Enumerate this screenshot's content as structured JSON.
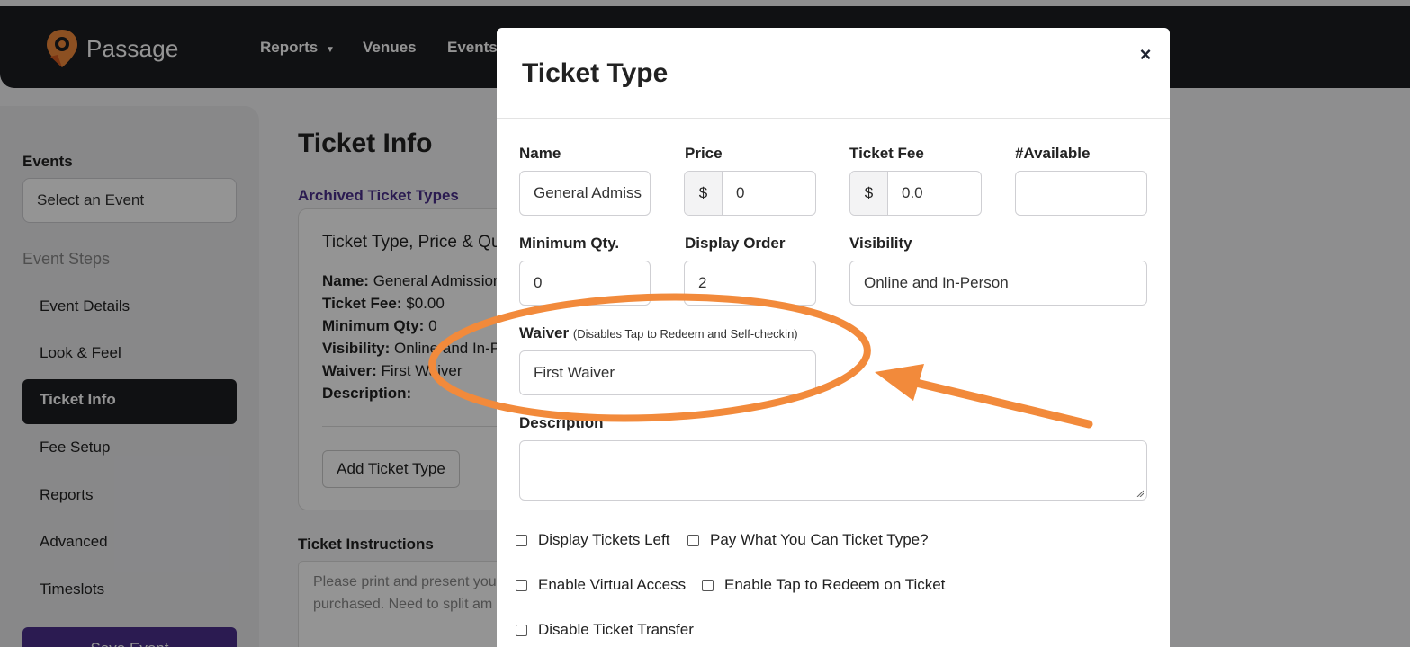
{
  "brand": {
    "name": "Passage",
    "accent": "#f28a3b"
  },
  "nav": {
    "reports": "Reports",
    "venues": "Venues",
    "events": "Events"
  },
  "sidebar": {
    "events_label": "Events",
    "event_select_placeholder": "Select an Event",
    "steps_label": "Event Steps",
    "items": [
      {
        "label": "Event Details"
      },
      {
        "label": "Look & Feel"
      },
      {
        "label": "Ticket Info"
      },
      {
        "label": "Fee Setup"
      },
      {
        "label": "Reports"
      },
      {
        "label": "Advanced"
      },
      {
        "label": "Timeslots"
      }
    ],
    "save_label": "Save Event"
  },
  "main": {
    "title": "Ticket Info",
    "archived_link": "Archived Ticket Types",
    "card": {
      "heading": "Ticket Type, Price & Qu",
      "name_label": "Name:",
      "name_value": "General Admission",
      "fee_label": "Ticket Fee:",
      "fee_value": "$0.00",
      "min_label": "Minimum Qty:",
      "min_value": "0",
      "visibility_label": "Visibility:",
      "visibility_value": "Online and In-Pe",
      "waiver_label": "Waiver:",
      "waiver_value": "First Waiver",
      "description_label": "Description:",
      "add_button": "Add Ticket Type"
    },
    "instructions": {
      "label": "Ticket Instructions",
      "line1": "Please print and present you",
      "line2": "purchased. Need to split am"
    }
  },
  "modal": {
    "title": "Ticket Type",
    "close": "×",
    "fields": {
      "name": {
        "label": "Name",
        "value": "General Admiss"
      },
      "price": {
        "label": "Price",
        "currency": "$",
        "value": "0"
      },
      "ticket_fee": {
        "label": "Ticket Fee",
        "currency": "$",
        "value": "0.0"
      },
      "available": {
        "label": "#Available",
        "value": ""
      },
      "min_qty": {
        "label": "Minimum Qty.",
        "value": "0"
      },
      "display_order": {
        "label": "Display Order",
        "value": "2"
      },
      "visibility": {
        "label": "Visibility",
        "value": "Online and In-Person"
      },
      "waiver": {
        "label": "Waiver",
        "note": "(Disables Tap to Redeem and Self-checkin)",
        "value": "First Waiver"
      },
      "description": {
        "label": "Description",
        "value": ""
      }
    },
    "checkboxes": {
      "display_tickets_left": "Display Tickets Left",
      "pay_what_you_can": "Pay What You Can Ticket Type?",
      "enable_virtual_access": "Enable Virtual Access",
      "enable_tap_to_redeem": "Enable Tap to Redeem on Ticket",
      "disable_ticket_transfer": "Disable Ticket Transfer"
    }
  },
  "annotation": {
    "color": "#f28a3b",
    "shapes": [
      "ellipse-highlight",
      "arrow"
    ]
  }
}
